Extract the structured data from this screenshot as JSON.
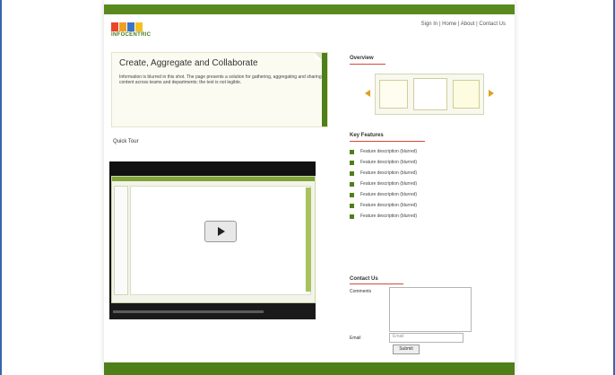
{
  "header": {
    "logo_colors": [
      "#e8452c",
      "#f0a020",
      "#3a74c8",
      "#f4c020",
      "#4f9a2a"
    ],
    "tagline": "INFOCENTRIC",
    "tagline_light": "",
    "top_links": "Sign In | Home | About | Contact Us"
  },
  "hero": {
    "title": "Create, Aggregate and Collaborate",
    "subtitle": "",
    "body": "Information is blurred in this shot. The page presents a solution for gathering, aggregating and sharing content across teams and departments; the text is not legible."
  },
  "quick_tour": {
    "label": "Quick Tour"
  },
  "video": {
    "play_label": "Play",
    "controls_label": "",
    "brand": ""
  },
  "overview": {
    "title": "Overview"
  },
  "key_features": {
    "title": "Key Features",
    "items": [
      "Feature description (blurred)",
      "Feature description (blurred)",
      "Feature description (blurred)",
      "Feature description (blurred)",
      "Feature description (blurred)",
      "Feature description (blurred)",
      "Feature description (blurred)"
    ]
  },
  "contact": {
    "title": "Contact Us",
    "comments_label": "Comments",
    "email_label": "Email",
    "email_placeholder": "Email",
    "submit_label": "Submit"
  },
  "footer": {
    "text": ""
  },
  "colors": {
    "brand_green": "#4f7f19",
    "accent_red": "#d34a3a",
    "frame_blue": "#3a64b0"
  }
}
